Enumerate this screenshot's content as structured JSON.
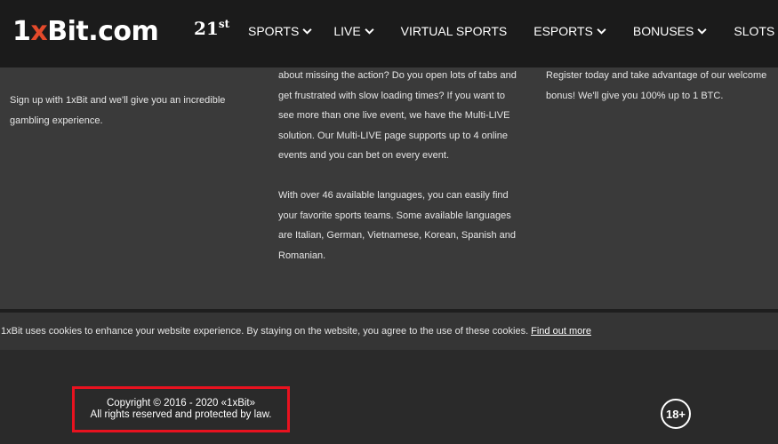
{
  "header": {
    "logo": {
      "prefix": "1",
      "mark": "x",
      "suffix": "Bit.com"
    },
    "badge": {
      "main": "21",
      "sup": "st"
    },
    "nav": [
      {
        "label": "SPORTS",
        "has_dropdown": true
      },
      {
        "label": "LIVE",
        "has_dropdown": true
      },
      {
        "label": "VIRTUAL SPORTS",
        "has_dropdown": false
      },
      {
        "label": "ESPORTS",
        "has_dropdown": true
      },
      {
        "label": "BONUSES",
        "has_dropdown": true
      },
      {
        "label": "SLOTS",
        "has_dropdown": true
      }
    ]
  },
  "content": {
    "left": "Sign up with 1xBit and we'll give you an incredible gambling experience.",
    "middle": [
      "about missing the action? Do you open lots of tabs and get frustrated with slow loading times? If you want to see more than one live event, we have the Multi-LIVE solution. Our Multi-LIVE page supports up to 4 online events and you can bet on every event.",
      "With over 46 available languages, you can easily find your favorite sports teams. Some available languages are Italian, German, Vietnamese, Korean, Spanish and Romanian."
    ],
    "right": "Register today and take advantage of our welcome bonus! We'll give you 100% up to 1 BTC."
  },
  "cookie": {
    "text": "1xBit uses cookies to enhance your website experience. By staying on the website, you agree to the use of these cookies.",
    "link": "Find out more"
  },
  "footer": {
    "copyright_line1": "Copyright © 2016 - 2020 «1xBit»",
    "copyright_line2": "All rights reserved and protected by law.",
    "age_badge": "18+"
  },
  "colors": {
    "header_bg": "#1b1b1b",
    "content_bg": "#3a3a3a",
    "footer_bg": "#2a2a2a",
    "brand_accent": "#e44a2b",
    "highlight_border": "#e8121f"
  }
}
